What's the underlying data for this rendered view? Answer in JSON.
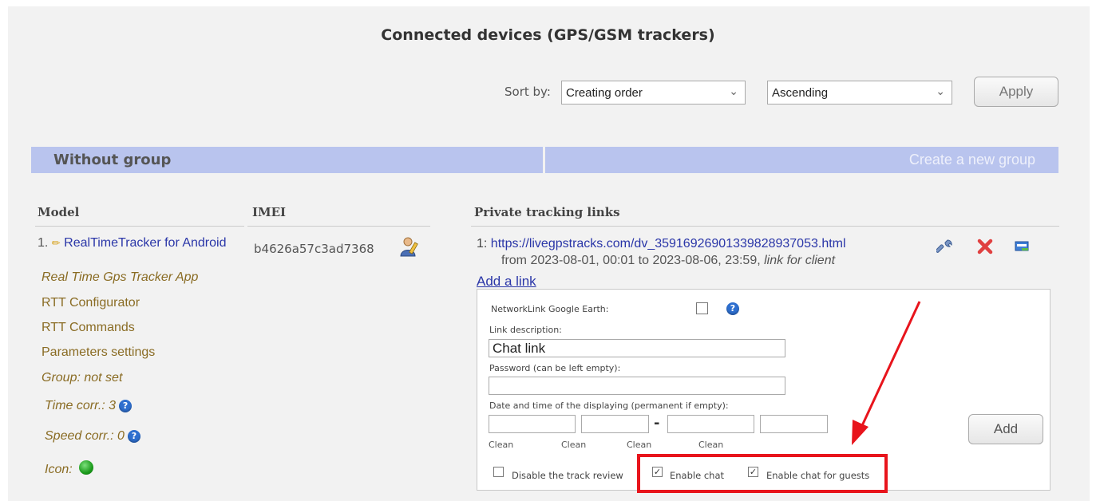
{
  "page": {
    "title": "Connected devices (GPS/GSM trackers)"
  },
  "sort": {
    "label": "Sort by:",
    "order_value": "Creating order",
    "direction_value": "Ascending",
    "apply_label": "Apply"
  },
  "group": {
    "title": "Without group",
    "create_label": "Create a new group"
  },
  "columns": {
    "model": "Model",
    "imei": "IMEI",
    "links": "Private tracking links"
  },
  "device": {
    "number": "1.",
    "name": "RealTimeTracker for Android",
    "app": "Real Time Gps Tracker App",
    "configurator": "RTT Configurator",
    "commands": "RTT Commands",
    "parameters": "Parameters settings",
    "group": "Group: not set",
    "time_corr": "Time corr.: 3",
    "speed_corr": "Speed corr.: 0",
    "icon_label": "Icon:",
    "imei": "b4626a57c3ad7368",
    "icon_color": "#1b9a1b"
  },
  "tracking_link": {
    "number": "1:",
    "url": "https://livegpstracks.com/dv_3591692690133982893705 3.html",
    "url_display": "https://livegpstracks.com/dv_35916926901339828937053.html",
    "period": "from 2023-08-01, 00:01 to 2023-08-06, 23:59,",
    "type": "link for client"
  },
  "add_link": "Add a link",
  "form": {
    "networklink_label": "NetworkLink Google Earth:",
    "description_label": "Link description:",
    "description_value": "Chat link",
    "password_label": "Password (can be left empty):",
    "password_value": "",
    "datetime_label": "Date and time of the displaying (permanent if empty):",
    "clean_label": "Clean",
    "range_separator": "-",
    "add_label": "Add",
    "disable_review_label": "Disable the track review",
    "enable_chat_label": "Enable chat",
    "enable_chat_guests_label": "Enable chat for guests",
    "networklink_checked": false,
    "disable_review_checked": false,
    "enable_chat_checked": true,
    "enable_chat_guests_checked": true
  },
  "colors": {
    "group_bar": "#b9c4ee",
    "link": "#2a36a8",
    "highlight": "#e8141c"
  }
}
